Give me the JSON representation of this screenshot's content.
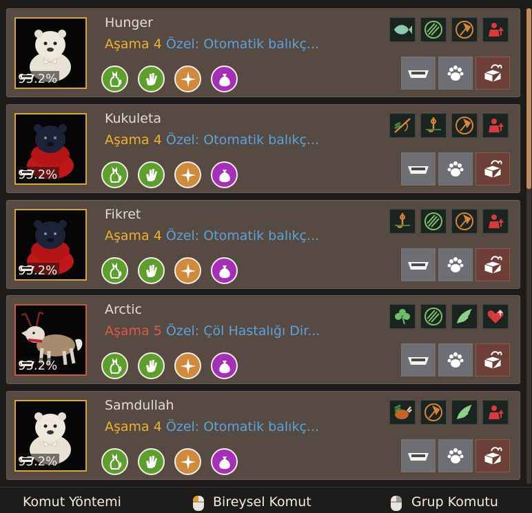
{
  "pets": [
    {
      "name": "Hunger",
      "stage_label": "Aşama",
      "stage_level": "4",
      "special": "Özel: Otomatik balıkç...",
      "satiety": "95.2%",
      "rare": false,
      "badges": [
        "fish-icon",
        "claw-swipe-icon",
        "axe-icon",
        "player-up-icon"
      ]
    },
    {
      "name": "Kukuleta",
      "stage_label": "Aşama",
      "stage_level": "4",
      "special": "Özel: Otomatik balıkç...",
      "satiety": "95.2%",
      "rare": false,
      "badges": [
        "rod-icon",
        "hook-icon",
        "axe-icon",
        "player-up-icon"
      ]
    },
    {
      "name": "Fikret",
      "stage_label": "Aşama",
      "stage_level": "4",
      "special": "Özel: Otomatik balıkç...",
      "satiety": "95.2%",
      "rare": false,
      "badges": [
        "hook-icon",
        "claw-swipe-icon",
        "axe-icon",
        "player-up-icon"
      ]
    },
    {
      "name": "Arctic",
      "stage_label": "Aşama",
      "stage_level": "5",
      "special": "Özel: Çöl Hastalığı Dir...",
      "satiety": "95.2%",
      "rare": true,
      "badges": [
        "clover-icon",
        "claw-swipe-icon",
        "wing-icon",
        "heart-up-icon"
      ]
    },
    {
      "name": "Samdullah",
      "stage_label": "Aşama",
      "stage_level": "4",
      "special": "Özel: Otomatik balıkç...",
      "satiety": "95.2%",
      "rare": false,
      "badges": [
        "roast-icon",
        "axe-icon",
        "wing-icon",
        "player-up-icon"
      ]
    }
  ],
  "skills": [
    "cat-skill-icon",
    "hand-skill-icon",
    "compass-skill-icon",
    "sack-skill-icon"
  ],
  "actions": [
    "feed-bowl-button",
    "paw-button",
    "release-box-button"
  ],
  "footer": {
    "command_mode": "Komut Yöntemi",
    "individual": "Bireysel Komut",
    "group": "Grup Komutu"
  },
  "colors": {
    "card": "#564a43",
    "gold": "#f2b12c",
    "red": "#e0584a",
    "blue": "#5aa3dc",
    "skill_green": "#5c9f2c",
    "skill_orange": "#cf8a3c",
    "skill_purple": "#a52fb8"
  }
}
